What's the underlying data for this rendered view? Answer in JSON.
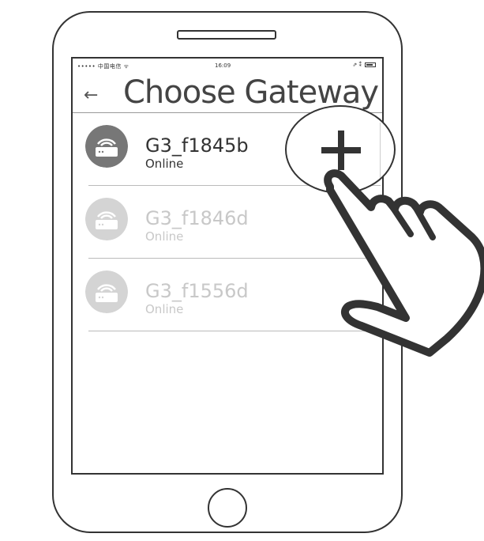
{
  "status_bar": {
    "carrier": "••••• 中国电信 ᯤ",
    "time": "16:09",
    "indicators": "⇗ ⁑"
  },
  "nav": {
    "back_icon": "←",
    "title": "Choose Gateway"
  },
  "add_button_icon": "plus-icon",
  "gateways": [
    {
      "name": "G3_f1845b",
      "status": "Online",
      "icon": "router-icon",
      "active": true
    },
    {
      "name": "G3_f1846d",
      "status": "Online",
      "icon": "router-icon",
      "active": false
    },
    {
      "name": "G3_f1556d",
      "status": "Online",
      "icon": "router-icon",
      "active": false
    }
  ],
  "colors": {
    "outline": "#333333",
    "active_icon": "#777777",
    "inactive_icon": "#d4d4d4"
  }
}
